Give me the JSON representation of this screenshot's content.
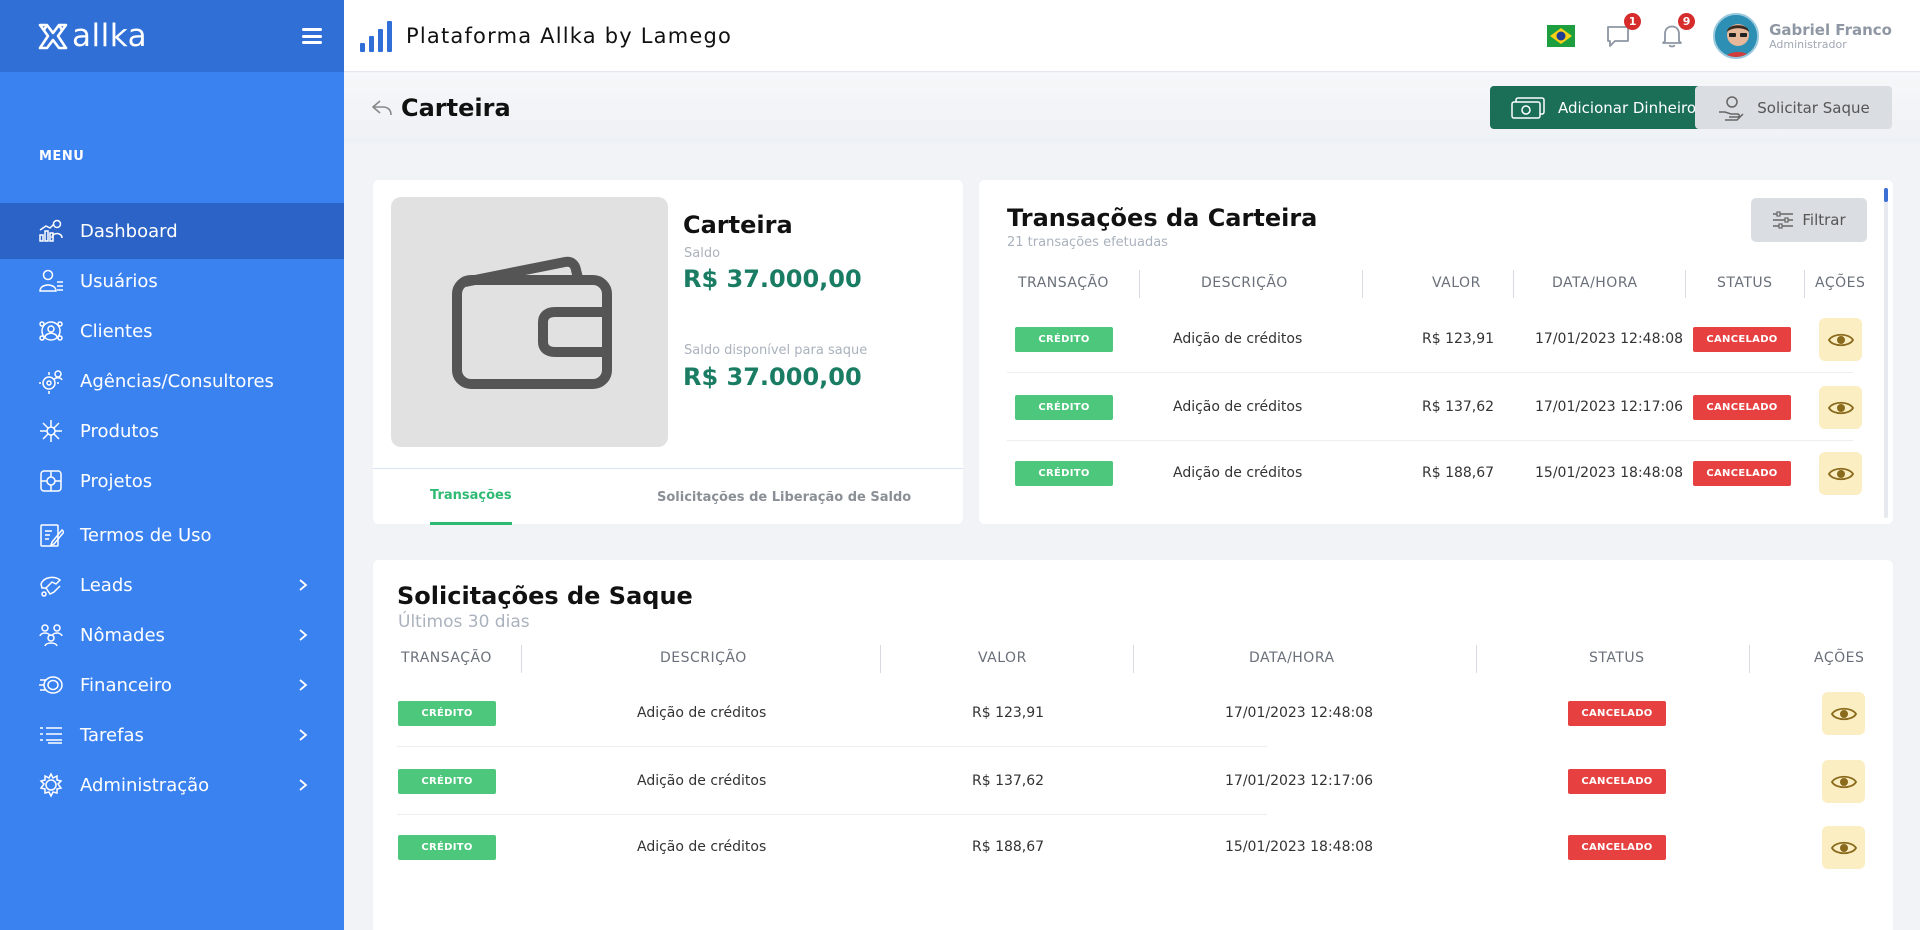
{
  "app": {
    "logo_text": "allka",
    "title": "Plataforma Allka by Lamego"
  },
  "sidebar": {
    "menu_label": "MENU",
    "items": [
      {
        "label": "Dashboard",
        "icon": "dashboard-icon",
        "active": true,
        "submenu": false
      },
      {
        "label": "Usuários",
        "icon": "users-icon",
        "submenu": false
      },
      {
        "label": "Clientes",
        "icon": "clients-icon",
        "submenu": false
      },
      {
        "label": "Agências/Consultores",
        "icon": "agencies-icon",
        "submenu": false
      },
      {
        "label": "Produtos",
        "icon": "products-icon",
        "submenu": false
      },
      {
        "label": "Projetos",
        "icon": "projects-icon",
        "submenu": false
      },
      {
        "label": "Termos de Uso",
        "icon": "terms-icon",
        "submenu": false
      },
      {
        "label": "Leads",
        "icon": "leads-icon",
        "submenu": true
      },
      {
        "label": "Nômades",
        "icon": "nomads-icon",
        "submenu": true
      },
      {
        "label": "Financeiro",
        "icon": "finance-icon",
        "submenu": true
      },
      {
        "label": "Tarefas",
        "icon": "tasks-icon",
        "submenu": true
      },
      {
        "label": "Administração",
        "icon": "admin-icon",
        "submenu": true
      }
    ]
  },
  "topbar": {
    "messages_count": "1",
    "notifications_count": "9",
    "user_name": "Gabriel Franco",
    "user_role": "Administrador"
  },
  "page": {
    "title": "Carteira",
    "add_money_label": "Adicionar Dinheiro",
    "withdraw_label": "Solicitar Saque"
  },
  "wallet": {
    "title": "Carteira",
    "balance_label": "Saldo",
    "balance_value": "R$ 37.000,00",
    "available_label": "Saldo disponível para saque",
    "available_value": "R$ 37.000,00",
    "tabs": [
      "Transações",
      "Solicitações de Liberação de Saldo"
    ]
  },
  "transactions": {
    "title": "Transações da Carteira",
    "subtitle": "21 transações efetuadas",
    "filter_label": "Filtrar",
    "columns": [
      "TRANSAÇÃO",
      "DESCRIÇÃO",
      "VALOR",
      "DATA/HORA",
      "STATUS",
      "AÇÕES"
    ],
    "rows": [
      {
        "type": "CRÉDITO",
        "description": "Adição de créditos",
        "value": "R$ 123,91",
        "datetime": "17/01/2023 12:48:08",
        "status": "CANCELADO"
      },
      {
        "type": "CRÉDITO",
        "description": "Adição de créditos",
        "value": "R$ 137,62",
        "datetime": "17/01/2023 12:17:06",
        "status": "CANCELADO"
      },
      {
        "type": "CRÉDITO",
        "description": "Adição de créditos",
        "value": "R$ 188,67",
        "datetime": "15/01/2023 18:48:08",
        "status": "CANCELADO"
      }
    ]
  },
  "withdrawals": {
    "title": "Solicitações de Saque",
    "subtitle": "Últimos 30 dias",
    "columns": [
      "TRANSAÇÃO",
      "DESCRIÇÃO",
      "VALOR",
      "DATA/HORA",
      "STATUS",
      "AÇÕES"
    ],
    "rows": [
      {
        "type": "CRÉDITO",
        "description": "Adição de créditos",
        "value": "R$ 123,91",
        "datetime": "17/01/2023 12:48:08",
        "status": "CANCELADO"
      },
      {
        "type": "CRÉDITO",
        "description": "Adição de créditos",
        "value": "R$ 137,62",
        "datetime": "17/01/2023 12:17:06",
        "status": "CANCELADO"
      },
      {
        "type": "CRÉDITO",
        "description": "Adição de créditos",
        "value": "R$ 188,67",
        "datetime": "15/01/2023 18:48:08",
        "status": "CANCELADO"
      }
    ]
  },
  "colors": {
    "sidebar": "#3b82f1",
    "sidebar_active": "#2b63c6",
    "primary_green": "#1a6f56",
    "credit_pill": "#4cc77c",
    "cancel_pill": "#e64040",
    "action_button": "#fbeec3"
  }
}
